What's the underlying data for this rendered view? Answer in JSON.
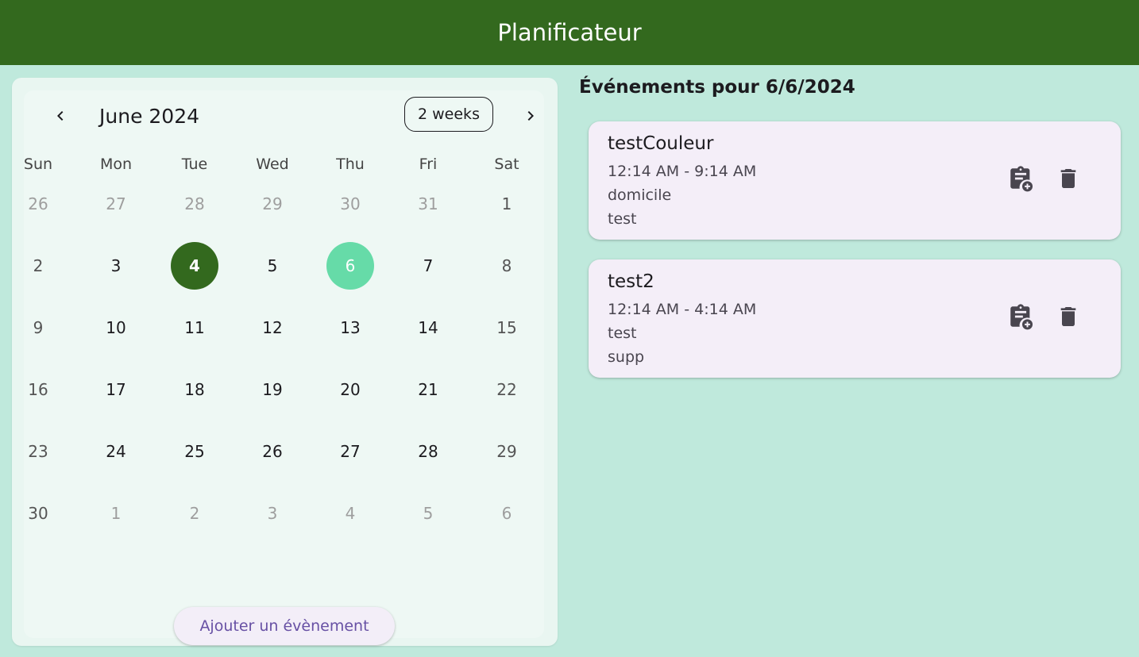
{
  "app": {
    "title": "Planificateur"
  },
  "calendar": {
    "month_label": "June 2024",
    "format_button": "2 weeks",
    "weekdays": [
      "Sun",
      "Mon",
      "Tue",
      "Wed",
      "Thu",
      "Fri",
      "Sat"
    ],
    "weeks": [
      [
        {
          "d": "26",
          "o": true
        },
        {
          "d": "27",
          "o": true
        },
        {
          "d": "28",
          "o": true
        },
        {
          "d": "29",
          "o": true
        },
        {
          "d": "30",
          "o": true
        },
        {
          "d": "31",
          "o": true
        },
        {
          "d": "1",
          "o": false
        }
      ],
      [
        {
          "d": "2",
          "o": false
        },
        {
          "d": "3",
          "o": false
        },
        {
          "d": "4",
          "o": false,
          "today": true
        },
        {
          "d": "5",
          "o": false
        },
        {
          "d": "6",
          "o": false,
          "selected": true
        },
        {
          "d": "7",
          "o": false
        },
        {
          "d": "8",
          "o": false
        }
      ],
      [
        {
          "d": "9",
          "o": false
        },
        {
          "d": "10",
          "o": false
        },
        {
          "d": "11",
          "o": false
        },
        {
          "d": "12",
          "o": false
        },
        {
          "d": "13",
          "o": false
        },
        {
          "d": "14",
          "o": false
        },
        {
          "d": "15",
          "o": false
        }
      ],
      [
        {
          "d": "16",
          "o": false
        },
        {
          "d": "17",
          "o": false
        },
        {
          "d": "18",
          "o": false
        },
        {
          "d": "19",
          "o": false
        },
        {
          "d": "20",
          "o": false
        },
        {
          "d": "21",
          "o": false
        },
        {
          "d": "22",
          "o": false
        }
      ],
      [
        {
          "d": "23",
          "o": false
        },
        {
          "d": "24",
          "o": false
        },
        {
          "d": "25",
          "o": false
        },
        {
          "d": "26",
          "o": false
        },
        {
          "d": "27",
          "o": false
        },
        {
          "d": "28",
          "o": false
        },
        {
          "d": "29",
          "o": false
        }
      ],
      [
        {
          "d": "30",
          "o": false
        },
        {
          "d": "1",
          "o": true
        },
        {
          "d": "2",
          "o": true
        },
        {
          "d": "3",
          "o": true
        },
        {
          "d": "4",
          "o": true
        },
        {
          "d": "5",
          "o": true
        },
        {
          "d": "6",
          "o": true
        }
      ]
    ],
    "add_button": "Ajouter un évènement"
  },
  "events_panel": {
    "title": "Événements pour 6/6/2024",
    "events": [
      {
        "name": "testCouleur",
        "time": "12:14 AM - 9:14 AM",
        "location": "domicile",
        "description": "test"
      },
      {
        "name": "test2",
        "time": "12:14 AM - 4:14 AM",
        "location": "test",
        "description": "supp"
      }
    ]
  },
  "colors": {
    "appbar": "#33691e",
    "background": "#bfe9dc",
    "today": "#33691e",
    "selected": "#66dba8",
    "accent_text": "#6750a4"
  },
  "icons": {
    "prev": "chevron-left-icon",
    "next": "chevron-right-icon",
    "copy": "clipboard-add-icon",
    "delete": "trash-icon"
  }
}
